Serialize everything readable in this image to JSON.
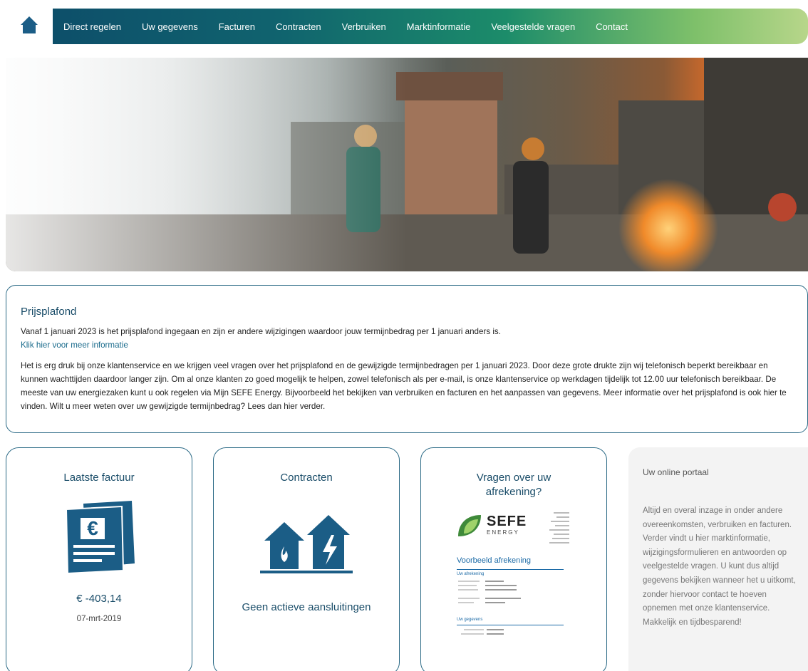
{
  "nav": {
    "items": [
      "Direct regelen",
      "Uw gegevens",
      "Facturen",
      "Contracten",
      "Verbruiken",
      "Marktinformatie",
      "Veelgestelde vragen",
      "Contact"
    ]
  },
  "info": {
    "title": "Prijsplafond",
    "intro": "Vanaf 1 januari 2023 is het prijsplafond ingegaan en zijn er andere wijzigingen waardoor jouw termijnbedrag per 1 januari anders is.",
    "link": "Klik hier voor meer informatie",
    "body": "Het is erg druk bij onze klantenservice en we krijgen veel vragen over het prijsplafond en de gewijzigde termijnbedragen per 1 januari 2023. Door deze grote drukte zijn wij telefonisch beperkt bereikbaar en kunnen wachttijden daardoor langer zijn. Om al onze klanten zo goed mogelijk te helpen, zowel telefonisch als per e-mail, is onze klantenservice op werkdagen tijdelijk tot 12.00 uur telefonisch bereikbaar. De meeste van uw energiezaken kunt u ook regelen via Mijn SEFE Energy. Bijvoorbeeld het bekijken van verbruiken en facturen en het aanpassen van gegevens. Meer informatie over het prijsplafond is ook hier te vinden. Wilt u meer weten over uw gewijzigde termijnbedrag? Lees dan hier verder."
  },
  "cards": {
    "invoice": {
      "title": "Laatste factuur",
      "amount": "€ -403,14",
      "date": "07-mrt-2019"
    },
    "contracts": {
      "title": "Contracten",
      "status": "Geen actieve aansluitingen"
    },
    "questions": {
      "title": "Vragen over uw afrekening?",
      "logo_text": "SEFE",
      "logo_sub": "ENERGY",
      "doc_heading": "Voorbeeld afrekening",
      "doc_section1": "Uw afrekening",
      "doc_section2": "Uw gegevens"
    }
  },
  "portal": {
    "title": "Uw online portaal",
    "text": "Altijd en overal inzage in onder andere overeenkomsten, verbruiken en facturen. Verder vindt u hier marktinformatie, wijzigingsformulieren en antwoorden op veelgestelde vragen. U kunt dus altijd gegevens bekijken wanneer het u uitkomt, zonder hiervoor contact te hoeven opnemen met onze klantenservice. Makkelijk en tijdbesparend!"
  },
  "colors": {
    "primary": "#1a4d69",
    "nav_start": "#0d4f6a",
    "nav_end": "#b7d68a",
    "icon": "#1b5d86"
  },
  "icons": [
    "home-icon",
    "invoice-euro-icon",
    "houses-gas-electric-icon",
    "sefe-logo"
  ]
}
